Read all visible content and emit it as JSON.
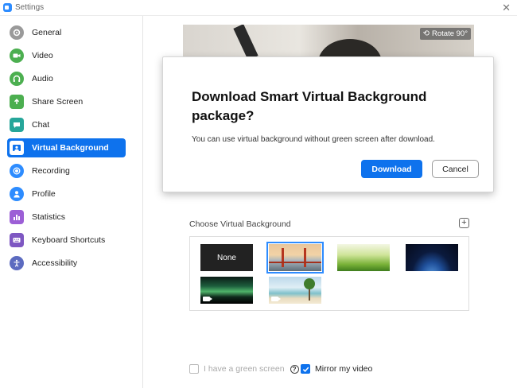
{
  "window": {
    "title": "Settings"
  },
  "sidebar": {
    "items": [
      {
        "label": "General",
        "icon": "gear-icon",
        "color": "#9a9a9a",
        "active": false
      },
      {
        "label": "Video",
        "icon": "video-camera-icon",
        "color": "#4caf50",
        "active": false
      },
      {
        "label": "Audio",
        "icon": "headphones-icon",
        "color": "#4caf50",
        "active": false
      },
      {
        "label": "Share Screen",
        "icon": "share-screen-icon",
        "color": "#4caf50",
        "active": false
      },
      {
        "label": "Chat",
        "icon": "chat-bubble-icon",
        "color": "#26a69a",
        "active": false
      },
      {
        "label": "Virtual Background",
        "icon": "virtual-background-icon",
        "color": "#2d8cff",
        "active": true
      },
      {
        "label": "Recording",
        "icon": "record-icon",
        "color": "#2d8cff",
        "active": false
      },
      {
        "label": "Profile",
        "icon": "person-icon",
        "color": "#2d8cff",
        "active": false
      },
      {
        "label": "Statistics",
        "icon": "bar-chart-icon",
        "color": "#9c5fd6",
        "active": false
      },
      {
        "label": "Keyboard Shortcuts",
        "icon": "keyboard-icon",
        "color": "#7e57c2",
        "active": false
      },
      {
        "label": "Accessibility",
        "icon": "accessibility-icon",
        "color": "#5c6bc0",
        "active": false
      }
    ],
    "accent_color": "#0e72ed"
  },
  "preview": {
    "rotate_label": "Rotate 90°"
  },
  "dialog": {
    "title": "Download Smart Virtual Background package?",
    "body": "You can use virtual background without green screen after download.",
    "download_label": "Download",
    "cancel_label": "Cancel"
  },
  "backgrounds": {
    "section_label": "Choose Virtual Background",
    "none_label": "None",
    "tiles": [
      {
        "name": "None",
        "selected": false
      },
      {
        "name": "Golden Gate Bridge",
        "selected": true
      },
      {
        "name": "Grass",
        "selected": false
      },
      {
        "name": "Earth from space",
        "selected": false
      },
      {
        "name": "Aurora",
        "selected": false
      },
      {
        "name": "Beach",
        "selected": false
      }
    ]
  },
  "options": {
    "green_screen_label": "I have a green screen",
    "green_screen_checked": false,
    "mirror_label": "Mirror my video",
    "mirror_checked": true
  }
}
